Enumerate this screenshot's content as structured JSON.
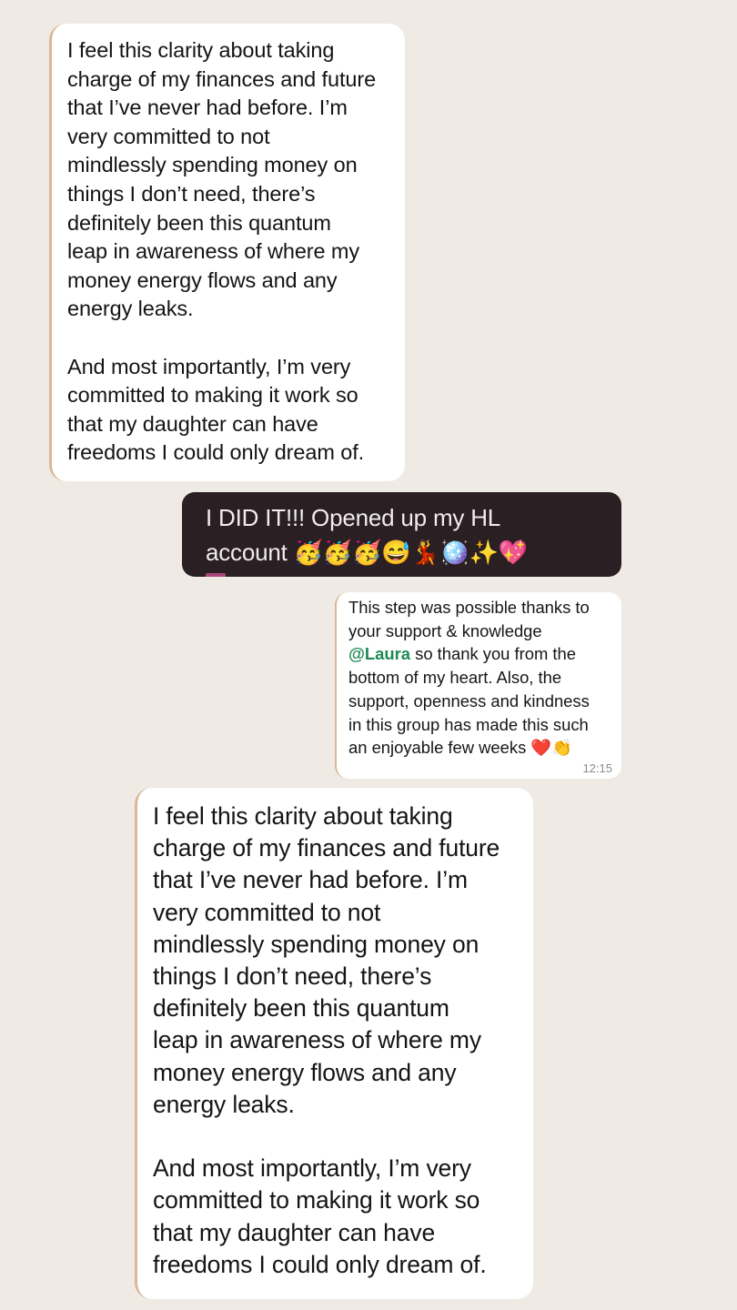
{
  "messages": [
    {
      "id": "m1",
      "text": "I feel this clarity about taking\ncharge of my finances and future\nthat I’ve never had before. I’m\nvery committed to not\nmindlessly spending money on\nthings I don’t need, there’s\ndefinitely been this quantum\nleap in awareness of where my\nmoney energy flows and any\nenergy leaks.\n\nAnd most importantly, I’m very\ncommitted to making it work so\nthat my daughter can have\nfreedoms I could only dream of."
    },
    {
      "id": "m2",
      "text": "I DID IT!!! Opened up my HL\naccount 🥳🥳🥳😅💃🪩✨💖"
    },
    {
      "id": "m3",
      "text_before_mention": "This step was possible thanks to\nyour support & knowledge\n",
      "mention": "@Laura",
      "text_after_mention": " so thank you from the\nbottom of my heart. Also, the\nsupport, openness and kindness\nin this group has made this such\nan enjoyable few weeks ❤️👏",
      "time": "12:15"
    },
    {
      "id": "m4",
      "text": "I feel this clarity about taking\ncharge of my finances and future\nthat I’ve never had before. I’m\nvery committed to not\nmindlessly spending money on\nthings I don’t need, there’s\ndefinitely been this quantum\nleap in awareness of where my\nmoney energy flows and any\nenergy leaks.\n\nAnd most importantly, I’m very\ncommitted to making it work so\nthat my daughter can have\nfreedoms I could only dream of."
    }
  ],
  "colors": {
    "background": "#efeae4",
    "bubble": "#ffffff",
    "dark_bubble": "#2a1f23",
    "mention": "#1e8a55",
    "quote_bar": "#d9b797"
  }
}
